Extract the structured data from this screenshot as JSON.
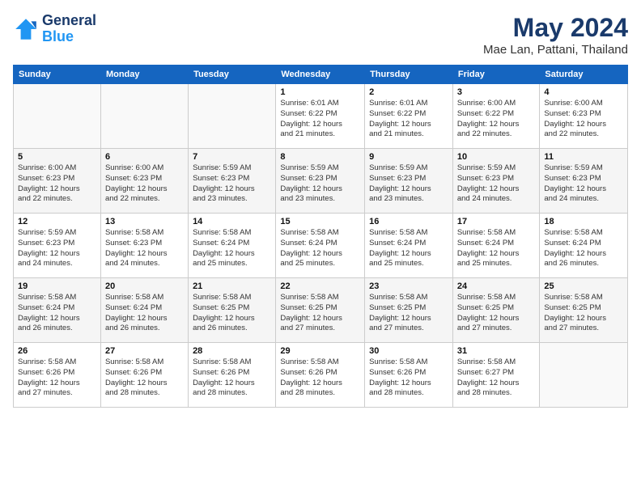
{
  "header": {
    "logo_line1": "General",
    "logo_line2": "Blue",
    "month": "May 2024",
    "location": "Mae Lan, Pattani, Thailand"
  },
  "weekdays": [
    "Sunday",
    "Monday",
    "Tuesday",
    "Wednesday",
    "Thursday",
    "Friday",
    "Saturday"
  ],
  "weeks": [
    [
      {
        "day": "",
        "info": ""
      },
      {
        "day": "",
        "info": ""
      },
      {
        "day": "",
        "info": ""
      },
      {
        "day": "1",
        "info": "Sunrise: 6:01 AM\nSunset: 6:22 PM\nDaylight: 12 hours\nand 21 minutes."
      },
      {
        "day": "2",
        "info": "Sunrise: 6:01 AM\nSunset: 6:22 PM\nDaylight: 12 hours\nand 21 minutes."
      },
      {
        "day": "3",
        "info": "Sunrise: 6:00 AM\nSunset: 6:22 PM\nDaylight: 12 hours\nand 22 minutes."
      },
      {
        "day": "4",
        "info": "Sunrise: 6:00 AM\nSunset: 6:23 PM\nDaylight: 12 hours\nand 22 minutes."
      }
    ],
    [
      {
        "day": "5",
        "info": "Sunrise: 6:00 AM\nSunset: 6:23 PM\nDaylight: 12 hours\nand 22 minutes."
      },
      {
        "day": "6",
        "info": "Sunrise: 6:00 AM\nSunset: 6:23 PM\nDaylight: 12 hours\nand 22 minutes."
      },
      {
        "day": "7",
        "info": "Sunrise: 5:59 AM\nSunset: 6:23 PM\nDaylight: 12 hours\nand 23 minutes."
      },
      {
        "day": "8",
        "info": "Sunrise: 5:59 AM\nSunset: 6:23 PM\nDaylight: 12 hours\nand 23 minutes."
      },
      {
        "day": "9",
        "info": "Sunrise: 5:59 AM\nSunset: 6:23 PM\nDaylight: 12 hours\nand 23 minutes."
      },
      {
        "day": "10",
        "info": "Sunrise: 5:59 AM\nSunset: 6:23 PM\nDaylight: 12 hours\nand 24 minutes."
      },
      {
        "day": "11",
        "info": "Sunrise: 5:59 AM\nSunset: 6:23 PM\nDaylight: 12 hours\nand 24 minutes."
      }
    ],
    [
      {
        "day": "12",
        "info": "Sunrise: 5:59 AM\nSunset: 6:23 PM\nDaylight: 12 hours\nand 24 minutes."
      },
      {
        "day": "13",
        "info": "Sunrise: 5:58 AM\nSunset: 6:23 PM\nDaylight: 12 hours\nand 24 minutes."
      },
      {
        "day": "14",
        "info": "Sunrise: 5:58 AM\nSunset: 6:24 PM\nDaylight: 12 hours\nand 25 minutes."
      },
      {
        "day": "15",
        "info": "Sunrise: 5:58 AM\nSunset: 6:24 PM\nDaylight: 12 hours\nand 25 minutes."
      },
      {
        "day": "16",
        "info": "Sunrise: 5:58 AM\nSunset: 6:24 PM\nDaylight: 12 hours\nand 25 minutes."
      },
      {
        "day": "17",
        "info": "Sunrise: 5:58 AM\nSunset: 6:24 PM\nDaylight: 12 hours\nand 25 minutes."
      },
      {
        "day": "18",
        "info": "Sunrise: 5:58 AM\nSunset: 6:24 PM\nDaylight: 12 hours\nand 26 minutes."
      }
    ],
    [
      {
        "day": "19",
        "info": "Sunrise: 5:58 AM\nSunset: 6:24 PM\nDaylight: 12 hours\nand 26 minutes."
      },
      {
        "day": "20",
        "info": "Sunrise: 5:58 AM\nSunset: 6:24 PM\nDaylight: 12 hours\nand 26 minutes."
      },
      {
        "day": "21",
        "info": "Sunrise: 5:58 AM\nSunset: 6:25 PM\nDaylight: 12 hours\nand 26 minutes."
      },
      {
        "day": "22",
        "info": "Sunrise: 5:58 AM\nSunset: 6:25 PM\nDaylight: 12 hours\nand 27 minutes."
      },
      {
        "day": "23",
        "info": "Sunrise: 5:58 AM\nSunset: 6:25 PM\nDaylight: 12 hours\nand 27 minutes."
      },
      {
        "day": "24",
        "info": "Sunrise: 5:58 AM\nSunset: 6:25 PM\nDaylight: 12 hours\nand 27 minutes."
      },
      {
        "day": "25",
        "info": "Sunrise: 5:58 AM\nSunset: 6:25 PM\nDaylight: 12 hours\nand 27 minutes."
      }
    ],
    [
      {
        "day": "26",
        "info": "Sunrise: 5:58 AM\nSunset: 6:26 PM\nDaylight: 12 hours\nand 27 minutes."
      },
      {
        "day": "27",
        "info": "Sunrise: 5:58 AM\nSunset: 6:26 PM\nDaylight: 12 hours\nand 28 minutes."
      },
      {
        "day": "28",
        "info": "Sunrise: 5:58 AM\nSunset: 6:26 PM\nDaylight: 12 hours\nand 28 minutes."
      },
      {
        "day": "29",
        "info": "Sunrise: 5:58 AM\nSunset: 6:26 PM\nDaylight: 12 hours\nand 28 minutes."
      },
      {
        "day": "30",
        "info": "Sunrise: 5:58 AM\nSunset: 6:26 PM\nDaylight: 12 hours\nand 28 minutes."
      },
      {
        "day": "31",
        "info": "Sunrise: 5:58 AM\nSunset: 6:27 PM\nDaylight: 12 hours\nand 28 minutes."
      },
      {
        "day": "",
        "info": ""
      }
    ]
  ]
}
